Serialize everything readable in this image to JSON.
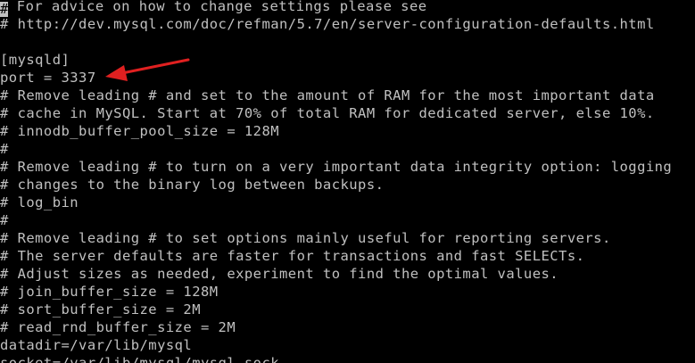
{
  "terminal": {
    "colors": {
      "background": "#000000",
      "text": "#c0c0c0",
      "annotation_arrow": "#e02020"
    },
    "cursor_char": "#",
    "lines": [
      " For advice on how to change settings please see",
      "# http://dev.mysql.com/doc/refman/5.7/en/server-configuration-defaults.html",
      "",
      "[mysqld]",
      "port = 3337",
      "# Remove leading # and set to the amount of RAM for the most important data",
      "# cache in MySQL. Start at 70% of total RAM for dedicated server, else 10%.",
      "# innodb_buffer_pool_size = 128M",
      "#",
      "# Remove leading # to turn on a very important data integrity option: logging",
      "# changes to the binary log between backups.",
      "# log_bin",
      "#",
      "# Remove leading # to set options mainly useful for reporting servers.",
      "# The server defaults are faster for transactions and fast SELECTs.",
      "# Adjust sizes as needed, experiment to find the optimal values.",
      "# join_buffer_size = 128M",
      "# sort_buffer_size = 2M",
      "# read_rnd_buffer_size = 2M",
      "datadir=/var/lib/mysql",
      "socket=/var/lib/mysql/mysql.sock"
    ]
  }
}
